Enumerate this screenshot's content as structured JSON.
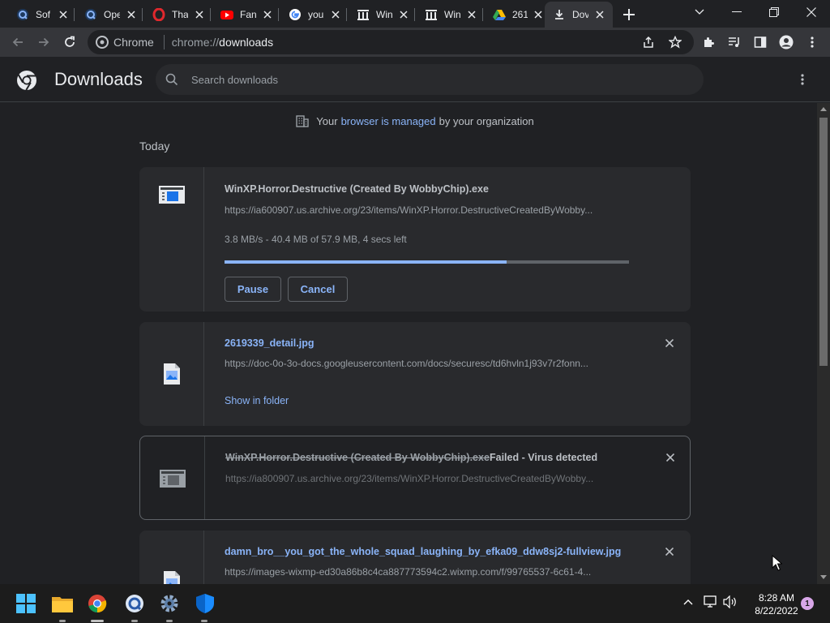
{
  "tabs": [
    {
      "title": "Sof",
      "icon": "q-icon",
      "color": "#4c8bf5"
    },
    {
      "title": "Ope",
      "icon": "q-icon",
      "color": "#4c8bf5"
    },
    {
      "title": "Tha",
      "icon": "opera-icon",
      "color": "#e0282d"
    },
    {
      "title": "Fan",
      "icon": "youtube-icon",
      "color": "#ff0000"
    },
    {
      "title": "you",
      "icon": "google-icon",
      "color": "#ffffff"
    },
    {
      "title": "Win",
      "icon": "archive-icon",
      "color": "#e8eaed"
    },
    {
      "title": "Win",
      "icon": "archive-icon",
      "color": "#e8eaed"
    },
    {
      "title": "261",
      "icon": "drive-icon",
      "color": "#34a853"
    },
    {
      "title": "Dov",
      "icon": "download-icon",
      "color": "#e8eaed"
    }
  ],
  "omnibox": {
    "chip": "Chrome",
    "scheme": "chrome://",
    "path": "downloads"
  },
  "header": {
    "title": "Downloads",
    "search_placeholder": "Search downloads"
  },
  "managed": {
    "before": "Your",
    "link": "browser is managed",
    "after": "by your organization"
  },
  "section_label": "Today",
  "downloads": [
    {
      "filename": "WinXP.Horror.Destructive (Created By WobbyChip).exe",
      "url": "https://ia600907.us.archive.org/23/items/WinXP.Horror.DestructiveCreatedByWobby...",
      "status": "3.8 MB/s - 40.4 MB of 57.9 MB, 4 secs left",
      "progress": 0.698,
      "pause_label": "Pause",
      "cancel_label": "Cancel"
    },
    {
      "filename": "2619339_detail.jpg",
      "url": "https://doc-0o-3o-docs.googleusercontent.com/docs/securesc/td6hvln1j93v7r2fonn...",
      "action": "Show in folder"
    },
    {
      "filename": "WinXP.Horror.Destructive (Created By WobbyChip).exe",
      "failed": "Failed - Virus detected",
      "url": "https://ia800907.us.archive.org/23/items/WinXP.Horror.DestructiveCreatedByWobby..."
    },
    {
      "filename": "damn_bro__you_got_the_whole_squad_laughing_by_efka09_ddw8sj2-fullview.jpg",
      "url": "https://images-wixmp-ed30a86b8c4ca887773594c2.wixmp.com/f/99765537-6c61-4..."
    }
  ],
  "taskbar": {
    "time": "8:28 AM",
    "date": "8/22/2022",
    "notifications": "1"
  },
  "colors": {
    "accent": "#8ab4f8",
    "bg": "#202124",
    "card": "#292a2d"
  }
}
